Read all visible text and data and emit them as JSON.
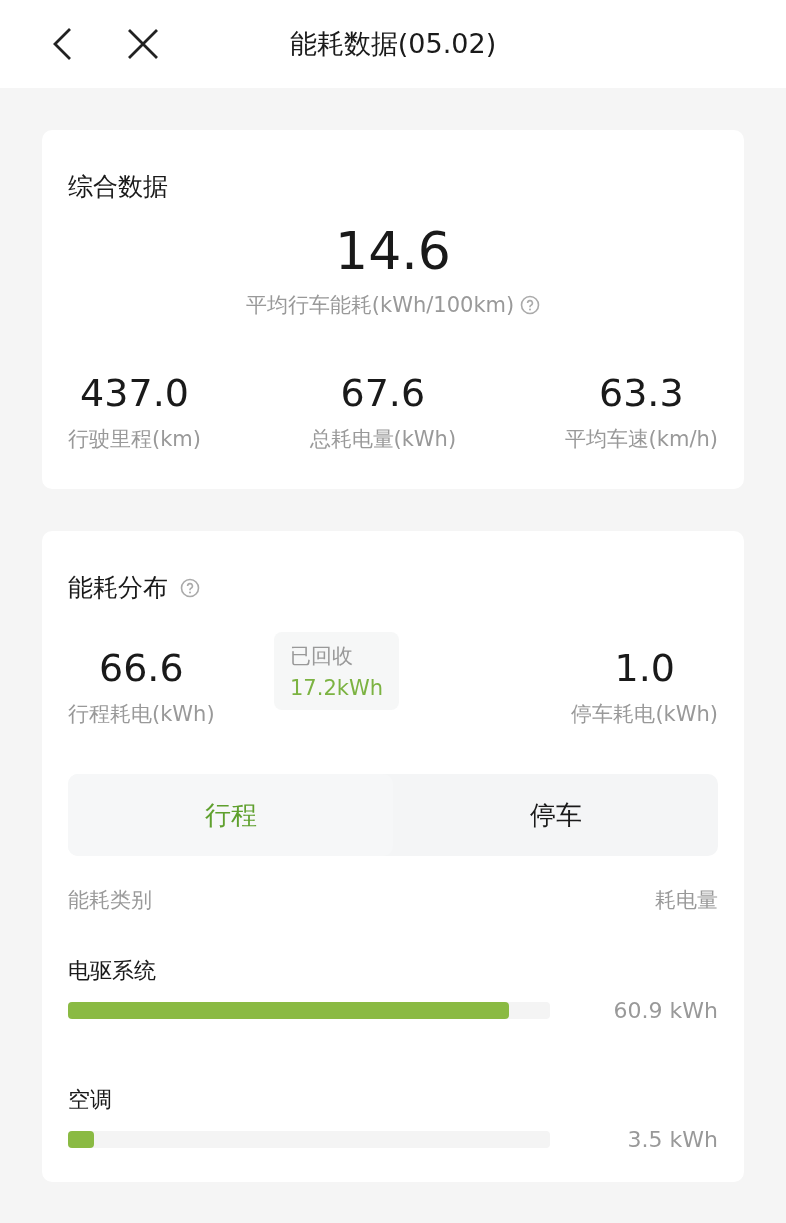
{
  "header": {
    "title": "能耗数据(05.02)"
  },
  "summary": {
    "title": "综合数据",
    "main": {
      "value": "14.6",
      "label": "平均行车能耗(kWh/100km)"
    },
    "stats": [
      {
        "value": "437.0",
        "label": "行驶里程(km)"
      },
      {
        "value": "67.6",
        "label": "总耗电量(kWh)"
      },
      {
        "value": "63.3",
        "label": "平均车速(km/h)"
      }
    ]
  },
  "distribution": {
    "title": "能耗分布",
    "trip": {
      "value": "66.6",
      "label": "行程耗电(kWh)"
    },
    "recovered": {
      "label": "已回收",
      "value": "17.2kWh"
    },
    "parking": {
      "value": "1.0",
      "label": "停车耗电(kWh)"
    },
    "tabs": [
      {
        "label": "行程",
        "selected": true
      },
      {
        "label": "停车",
        "selected": false
      }
    ],
    "columns": [
      "能耗类别",
      "耗电量"
    ],
    "rows": [
      {
        "name": "电驱系统",
        "level": 0.915,
        "reading": "60.9 kWh"
      },
      {
        "name": "空调",
        "level": 0.054,
        "reading": "3.5 kWh"
      }
    ]
  }
}
